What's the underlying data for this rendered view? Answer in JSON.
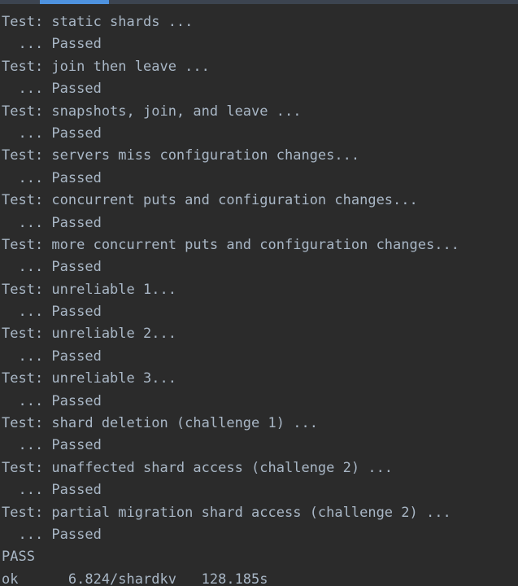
{
  "window": {
    "background_color": "#2b2b2b",
    "tab_strip_color": "#3c4450",
    "active_tab_indicator_color": "#4e92df",
    "text_color": "#a9b7c6"
  },
  "tab_strip": {
    "active_tab_name": "run-tab-indicator"
  },
  "console": {
    "lines": [
      "Test: static shards ...",
      "  ... Passed",
      "Test: join then leave ...",
      "  ... Passed",
      "Test: snapshots, join, and leave ...",
      "  ... Passed",
      "Test: servers miss configuration changes...",
      "  ... Passed",
      "Test: concurrent puts and configuration changes...",
      "  ... Passed",
      "Test: more concurrent puts and configuration changes...",
      "  ... Passed",
      "Test: unreliable 1...",
      "  ... Passed",
      "Test: unreliable 2...",
      "  ... Passed",
      "Test: unreliable 3...",
      "  ... Passed",
      "Test: shard deletion (challenge 1) ...",
      "  ... Passed",
      "Test: unaffected shard access (challenge 2) ...",
      "  ... Passed",
      "Test: partial migration shard access (challenge 2) ...",
      "  ... Passed",
      "PASS",
      "ok      6.824/shardkv   128.185s"
    ],
    "summary": {
      "result": "PASS",
      "status": "ok",
      "package": "6.824/shardkv",
      "elapsed": "128.185s"
    }
  }
}
